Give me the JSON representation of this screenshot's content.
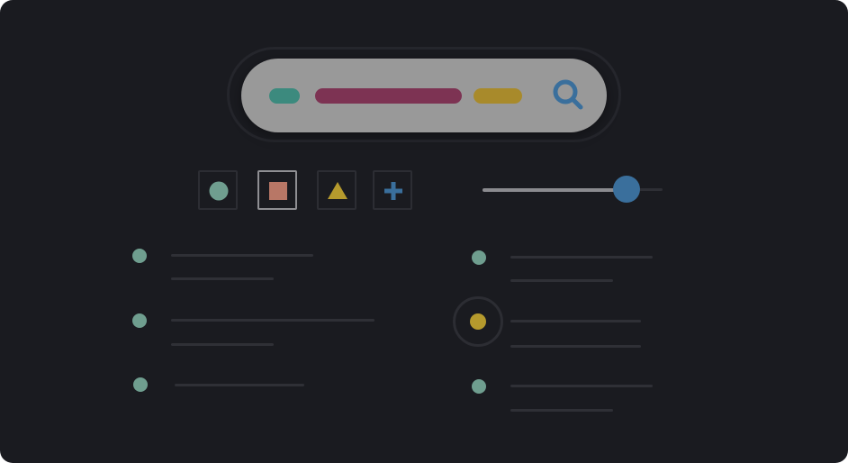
{
  "colors": {
    "background": "#1a1b20",
    "search_bar": "#999999",
    "chip_teal": "#3c8a7e",
    "chip_magenta": "#7d3353",
    "chip_gold": "#a88a2b",
    "search_icon": "#3a6f9c",
    "circle_tool": "#6f9e8f",
    "square_tool": "#b87766",
    "triangle_tool": "#b59a2d",
    "plus_tool": "#3a6f9c",
    "dot_default": "#6f9e8f",
    "dot_active": "#b59a2d",
    "slider_thumb": "#3a6f9c"
  },
  "search": {
    "icon": "search-icon",
    "tags": [
      "teal-tag",
      "magenta-tag",
      "gold-tag"
    ]
  },
  "toolbar": {
    "tools": [
      {
        "icon": "circle-icon",
        "selected": false
      },
      {
        "icon": "square-icon",
        "selected": true
      },
      {
        "icon": "triangle-icon",
        "selected": false
      },
      {
        "icon": "plus-icon",
        "selected": false
      }
    ]
  },
  "slider": {
    "value": 0.8
  },
  "lists": {
    "left": [
      {
        "state": "default",
        "lines": 2
      },
      {
        "state": "default",
        "lines": 2
      },
      {
        "state": "default",
        "lines": 1
      }
    ],
    "right": [
      {
        "state": "default",
        "lines": 2
      },
      {
        "state": "active",
        "lines": 2
      },
      {
        "state": "default",
        "lines": 2
      }
    ]
  }
}
